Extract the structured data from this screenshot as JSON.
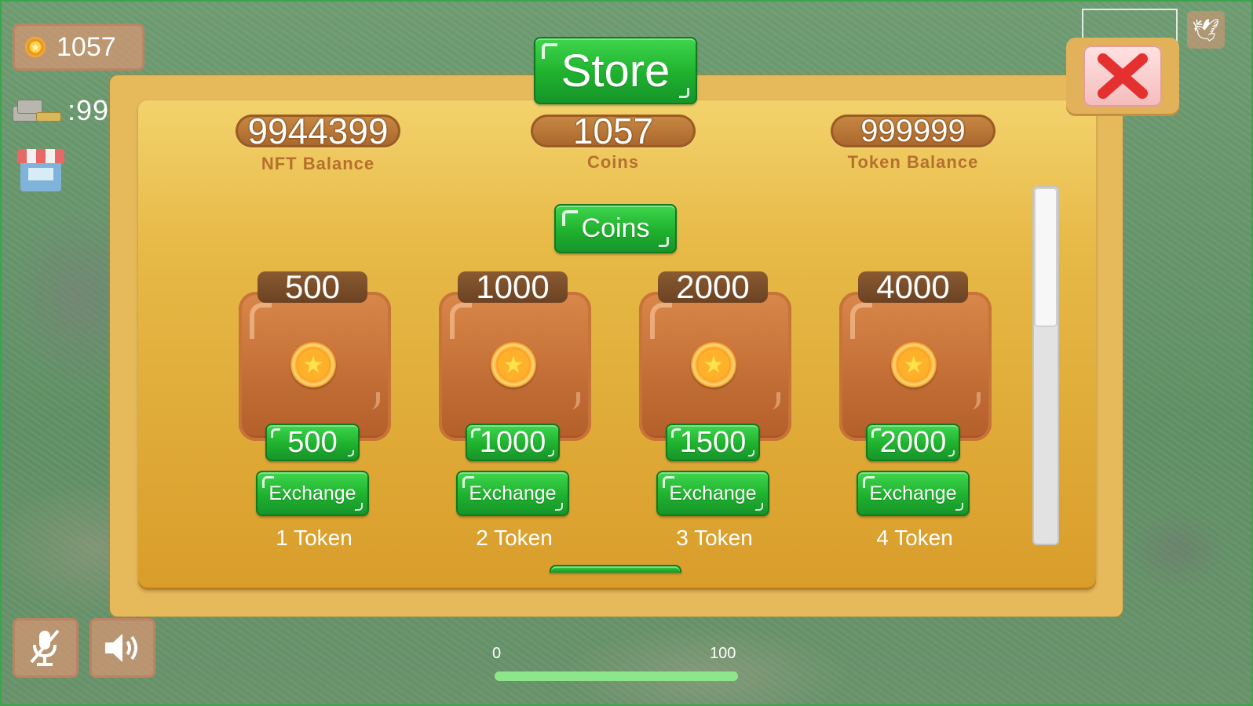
{
  "hud": {
    "coins": "1057",
    "money": ":99"
  },
  "progress": {
    "min": "0",
    "max": "100",
    "level": 1.0
  },
  "store": {
    "title": "Store",
    "balances": {
      "nft_value": "9944399",
      "nft_label": "NFT Balance",
      "coins_value": "1057",
      "coins_label": "Coins",
      "token_value": "999999",
      "token_label": "Token Balance"
    },
    "tab": "Coins",
    "items": [
      {
        "amount": "500",
        "price": "500",
        "button": "Exchange",
        "cost": "1 Token"
      },
      {
        "amount": "1000",
        "price": "1000",
        "button": "Exchange",
        "cost": "2 Token"
      },
      {
        "amount": "2000",
        "price": "1500",
        "button": "Exchange",
        "cost": "3 Token"
      },
      {
        "amount": "4000",
        "price": "2000",
        "button": "Exchange",
        "cost": "4 Token"
      }
    ]
  },
  "icons": {
    "coin": "coin-icon",
    "money": "money-stack-icon",
    "shop": "shop-icon",
    "close": "close-icon",
    "bird": "bird-icon",
    "mic_off": "mic-off-icon",
    "sound": "speaker-icon"
  },
  "colors": {
    "accent_green": "#1fb12e",
    "panel_gold": "#e7b947",
    "close_red": "#e53030"
  }
}
